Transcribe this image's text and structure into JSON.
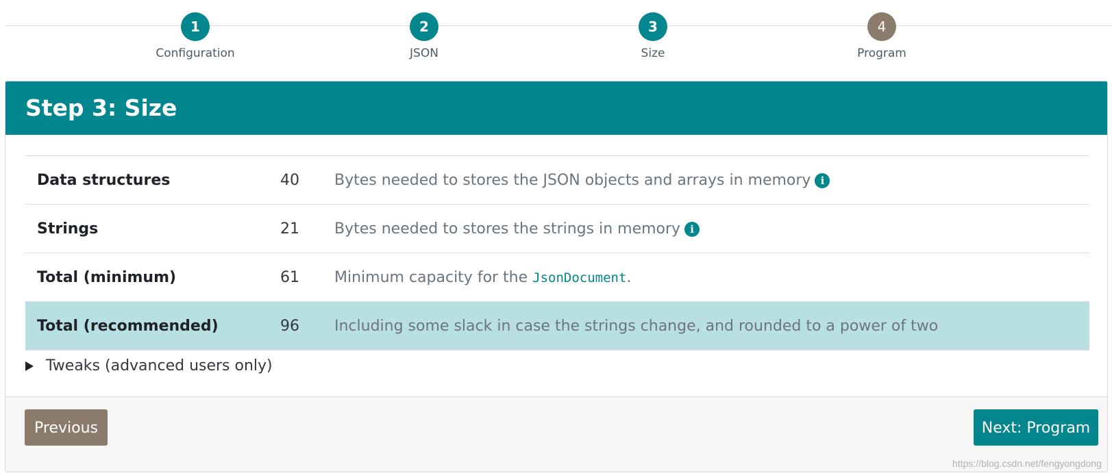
{
  "stepper": {
    "steps": [
      {
        "number": "1",
        "label": "Configuration"
      },
      {
        "number": "2",
        "label": "JSON"
      },
      {
        "number": "3",
        "label": "Size"
      },
      {
        "number": "4",
        "label": "Program"
      }
    ]
  },
  "card": {
    "title": "Step 3: Size"
  },
  "table": {
    "rows": [
      {
        "label": "Data structures",
        "value": "40",
        "description": "Bytes needed to stores the JSON objects and arrays in memory"
      },
      {
        "label": "Strings",
        "value": "21",
        "description": "Bytes needed to stores the strings in memory"
      },
      {
        "label": "Total (minimum)",
        "value": "61",
        "description_before": "Minimum capacity for the ",
        "code": "JsonDocument",
        "description_after": "."
      },
      {
        "label": "Total (recommended)",
        "value": "96",
        "description": "Including some slack in case the strings change, and rounded to a power of two"
      }
    ]
  },
  "tweaks": {
    "label": "Tweaks (advanced users only)"
  },
  "footer": {
    "previous_label": "Previous",
    "next_label": "Next: Program"
  },
  "icons": {
    "info": "i"
  },
  "watermark": "https://blog.csdn.net/fengyongdong",
  "colors": {
    "accent": "#03868d",
    "secondary": "#8b7b6b",
    "highlight_row": "#b8dfe2"
  }
}
